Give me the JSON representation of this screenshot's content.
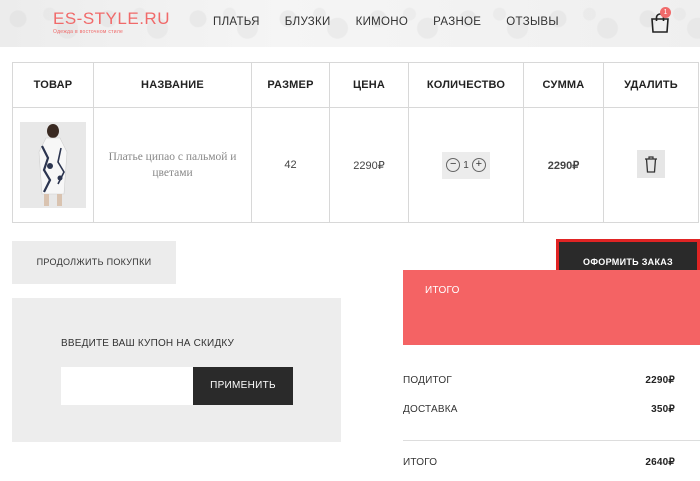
{
  "header": {
    "logo_text": "ES-STYLE.RU",
    "logo_subtitle": "Одежда в восточном стиле",
    "nav": [
      "ПЛАТЬЯ",
      "БЛУЗКИ",
      "КИМОНО",
      "РАЗНОЕ",
      "ОТЗЫВЫ"
    ],
    "cart_count": "1",
    "cart_icon": "shopping-bag-icon"
  },
  "table": {
    "headers": [
      "ТОВАР",
      "НАЗВАНИЕ",
      "РАЗМЕР",
      "ЦЕНА",
      "КОЛИЧЕСТВО",
      "СУММА",
      "УДАЛИТЬ"
    ],
    "rows": [
      {
        "image_icon": "dress-thumbnail",
        "name": "Платье ципао с пальмой и цветами",
        "size": "42",
        "price": "2290₽",
        "qty_minus": "−",
        "qty": "1",
        "qty_plus": "+",
        "sum": "2290₽",
        "delete_icon": "trash-icon"
      }
    ]
  },
  "actions": {
    "continue": "ПРОДОЛЖИТЬ ПОКУПКИ",
    "checkout": "ОФОРМИТЬ ЗАКАЗ"
  },
  "coupon": {
    "label": "ВВЕДИТЕ ВАШ КУПОН НА СКИДКУ",
    "input_value": "",
    "apply": "ПРИМЕНИТЬ"
  },
  "totals": {
    "heading": "ИТОГО",
    "subtotal_label": "ПОДИТОГ",
    "subtotal_value": "2290₽",
    "delivery_label": "ДОСТАВКА",
    "delivery_value": "350₽",
    "total_label": "ИТОГО",
    "total_value": "2640₽"
  },
  "colors": {
    "accent": "#f46364",
    "dark": "#2a2a2a",
    "highlight_border": "#e02424"
  }
}
